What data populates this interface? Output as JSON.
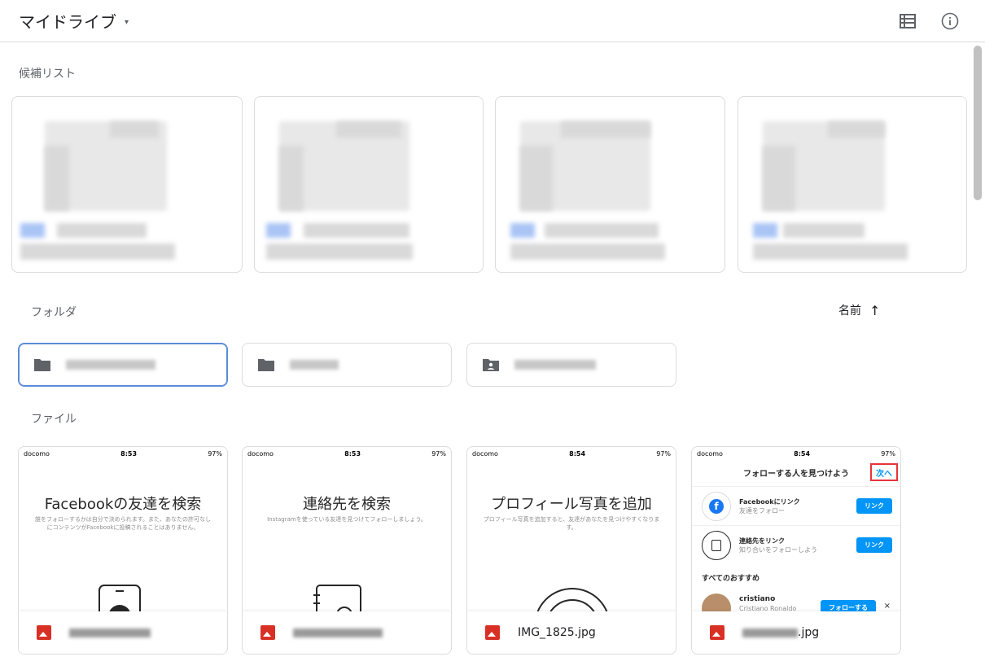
{
  "header": {
    "title": "マイドライブ",
    "caret": "▾"
  },
  "sections": {
    "suggested": "候補リスト",
    "folders": "フォルダ",
    "files": "ファイル"
  },
  "sort": {
    "label": "名前",
    "arrow": "↑"
  },
  "icons": {
    "list_view": "list-view-icon",
    "info": "info-icon",
    "folder": "folder-icon",
    "shared_folder": "shared-folder-icon",
    "image_file": "image-file-icon"
  },
  "files": [
    {
      "status": {
        "carrier": "docomo",
        "time": "8:53",
        "battery": "97%"
      },
      "heading": "Facebookの友達を検索",
      "sub": "誰をフォローするかは自分で決められます。また、あなたの許可なしにコンテンツがFacebookに投稿されることはありません。",
      "name_suffix": ""
    },
    {
      "status": {
        "carrier": "docomo",
        "time": "8:53",
        "battery": "97%"
      },
      "heading": "連絡先を検索",
      "sub": "Instagramを使っている友達を見つけてフォローしましょう。",
      "name_suffix": ""
    },
    {
      "status": {
        "carrier": "docomo",
        "time": "8:54",
        "battery": "97%"
      },
      "heading": "プロフィール写真を追加",
      "sub": "プロフィール写真を追加すると、友達があなたを見つけやすくなります。",
      "name_suffix": "IMG_1825.jpg"
    },
    {
      "status": {
        "carrier": "docomo",
        "time": "8:54",
        "battery": "97%"
      },
      "heading": "フォローする人を見つけよう",
      "next": "次へ",
      "fb_title": "Facebookにリンク",
      "fb_sub": "友達をフォロー",
      "contacts_title": "連絡先をリンク",
      "contacts_sub": "知り合いをフォローしよう",
      "link_btn": "リンク",
      "all_reco": "すべてのおすすめ",
      "user": "cristiano",
      "user_full": "Cristiano Ronaldo",
      "follow_btn": "フォローする",
      "dismiss": "×",
      "name_suffix": ".jpg"
    }
  ],
  "colors": {
    "highlight": "#e8333a",
    "folder_selected": "#5b8bd8",
    "image_icon": "#d93025",
    "ig_blue": "#0095f6"
  }
}
